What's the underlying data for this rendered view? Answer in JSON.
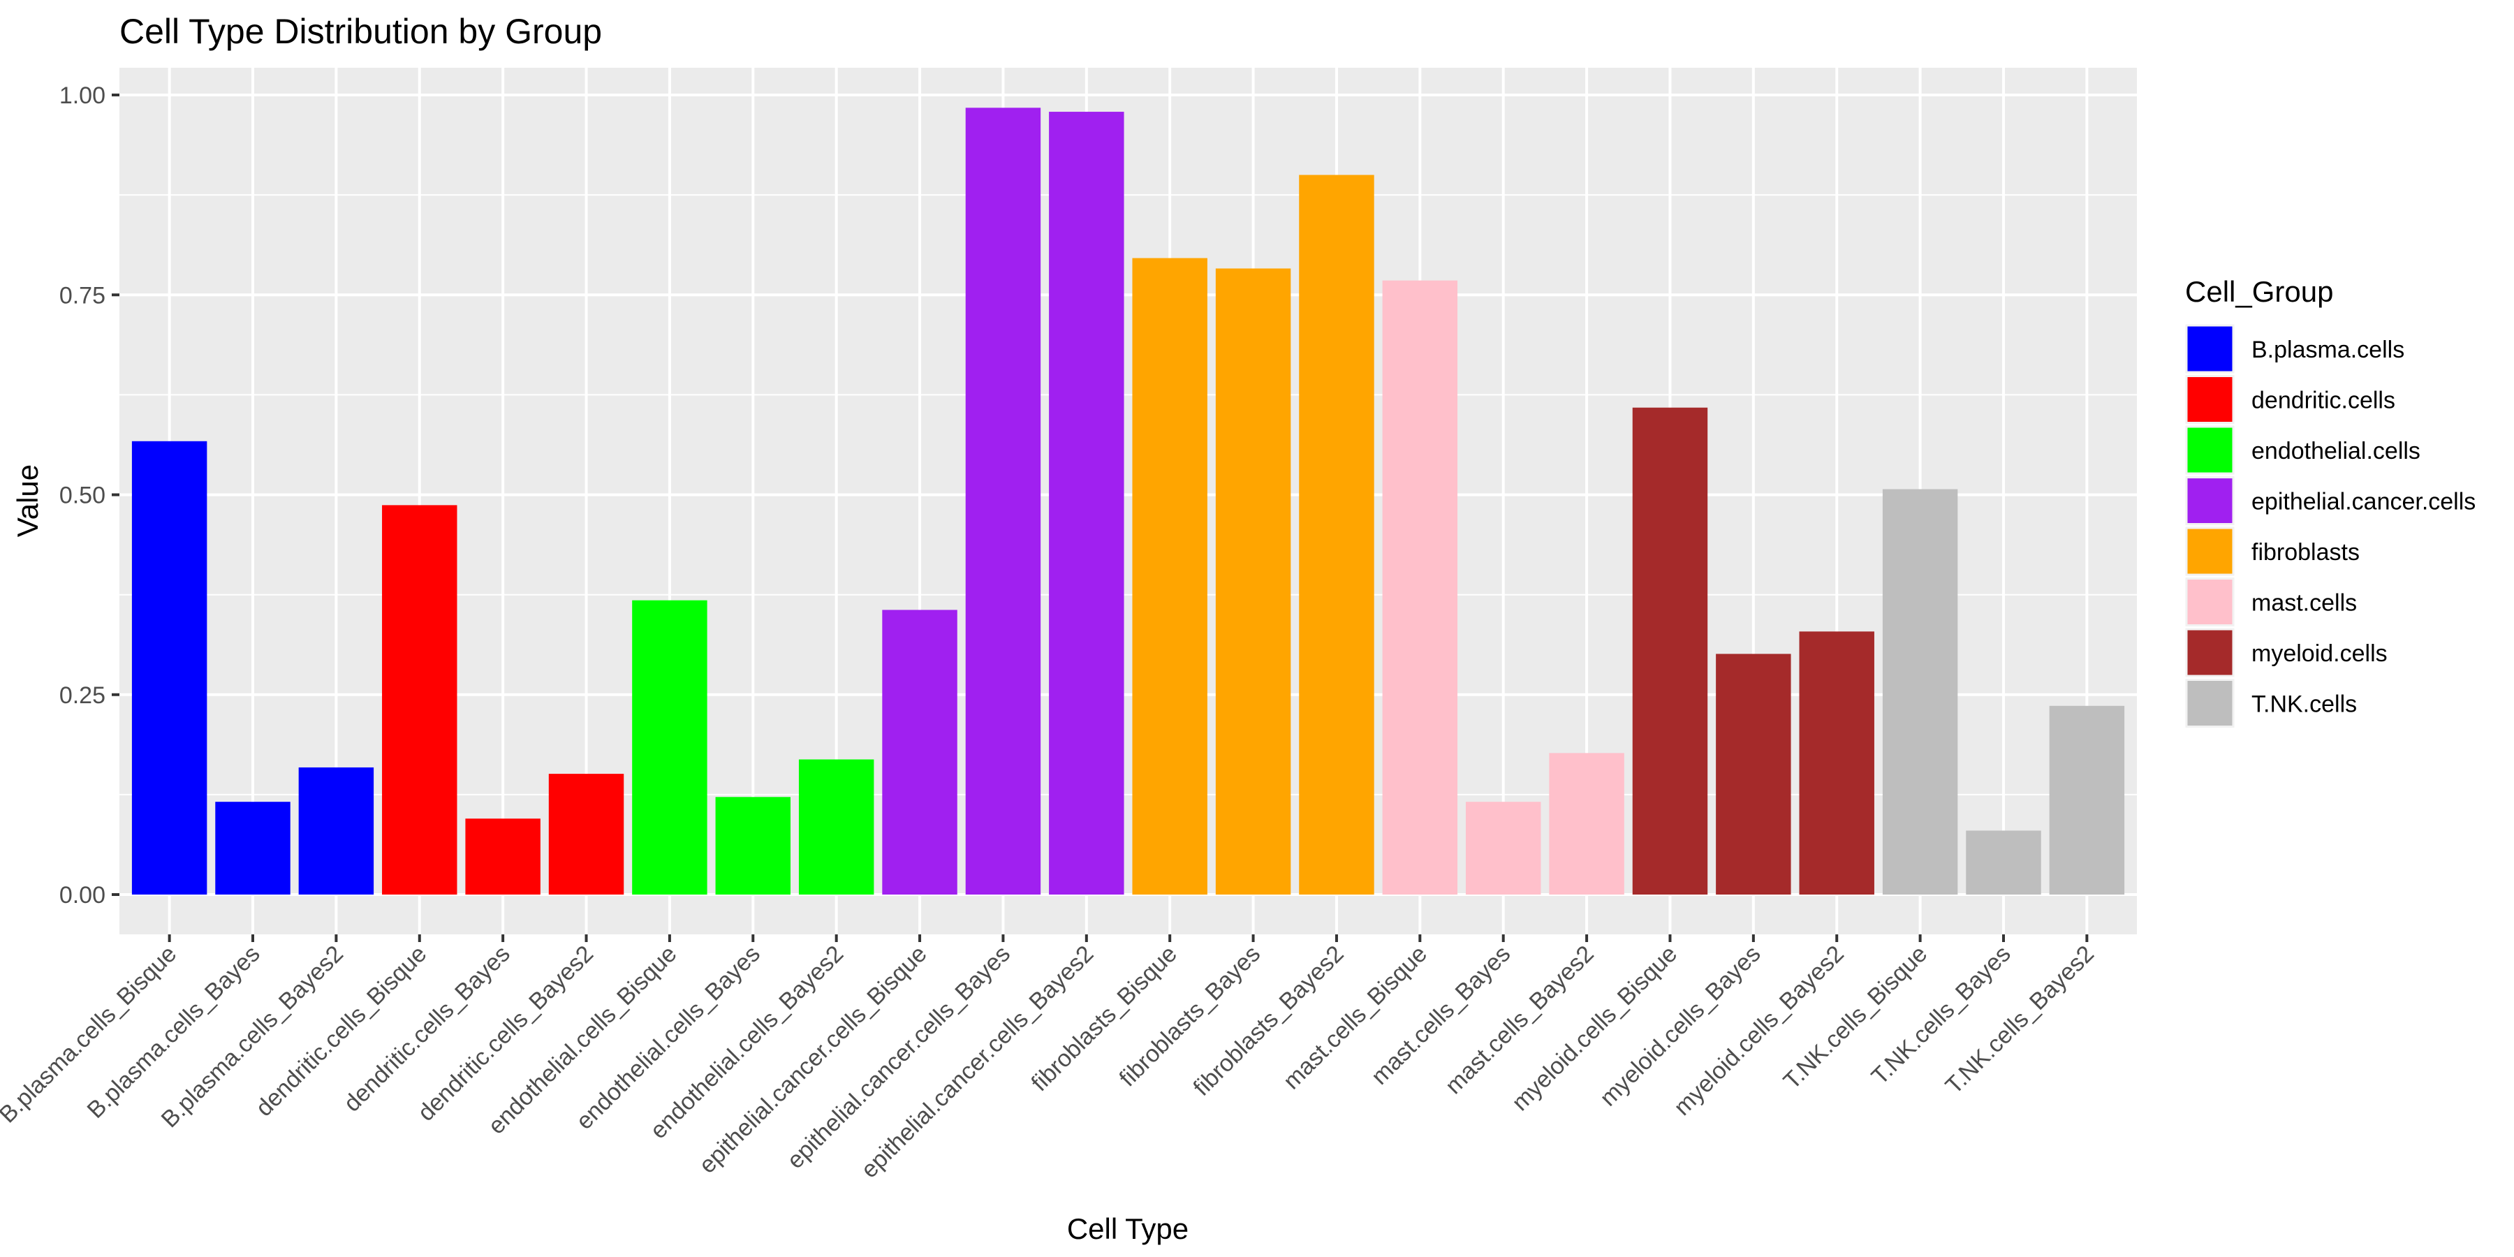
{
  "chart_data": {
    "type": "bar",
    "title": "Cell Type Distribution by Group",
    "xlabel": "Cell Type",
    "ylabel": "Value",
    "ylim": [
      0,
      1.0
    ],
    "yticks": [
      "0.00",
      "0.25",
      "0.50",
      "0.75",
      "1.00"
    ],
    "ytick_values": [
      0,
      0.25,
      0.5,
      0.75,
      1.0
    ],
    "grid": true,
    "legend_position": "right",
    "legend": {
      "title": "Cell_Group",
      "entries": [
        {
          "label": "B.plasma.cells",
          "color": "#0000FF"
        },
        {
          "label": "dendritic.cells",
          "color": "#FF0000"
        },
        {
          "label": "endothelial.cells",
          "color": "#00FF00"
        },
        {
          "label": "epithelial.cancer.cells",
          "color": "#A020F0"
        },
        {
          "label": "fibroblasts",
          "color": "#FFA500"
        },
        {
          "label": "mast.cells",
          "color": "#FFC0CB"
        },
        {
          "label": "myeloid.cells",
          "color": "#A52A2A"
        },
        {
          "label": "T.NK.cells",
          "color": "#BEBEBE"
        }
      ]
    },
    "categories": [
      "B.plasma.cells_Bisque",
      "B.plasma.cells_Bayes",
      "B.plasma.cells_Bayes2",
      "dendritic.cells_Bisque",
      "dendritic.cells_Bayes",
      "dendritic.cells_Bayes2",
      "endothelial.cells_Bisque",
      "endothelial.cells_Bayes",
      "endothelial.cells_Bayes2",
      "epithelial.cancer.cells_Bisque",
      "epithelial.cancer.cells_Bayes",
      "epithelial.cancer.cells_Bayes2",
      "fibroblasts_Bisque",
      "fibroblasts_Bayes",
      "fibroblasts_Bayes2",
      "mast.cells_Bisque",
      "mast.cells_Bayes",
      "mast.cells_Bayes2",
      "myeloid.cells_Bisque",
      "myeloid.cells_Bayes",
      "myeloid.cells_Bayes2",
      "T.NK.cells_Bisque",
      "T.NK.cells_Bayes",
      "T.NK.cells_Bayes2"
    ],
    "groups": [
      0,
      0,
      0,
      1,
      1,
      1,
      2,
      2,
      2,
      3,
      3,
      3,
      4,
      4,
      4,
      5,
      5,
      5,
      6,
      6,
      6,
      7,
      7,
      7
    ],
    "values": [
      0.567,
      0.116,
      0.159,
      0.487,
      0.095,
      0.151,
      0.368,
      0.122,
      0.169,
      0.356,
      0.984,
      0.979,
      0.796,
      0.783,
      0.9,
      0.768,
      0.116,
      0.177,
      0.609,
      0.301,
      0.329,
      0.507,
      0.08,
      0.236
    ]
  }
}
